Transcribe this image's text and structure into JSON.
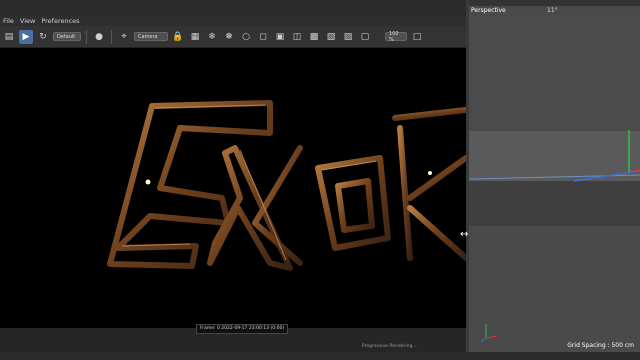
{
  "menu": {
    "items": [
      "File",
      "View",
      "Preferences"
    ]
  },
  "toolbar": {
    "render_preset": "Default",
    "camera_dropdown": "Camera",
    "zoom": "100 %"
  },
  "render_view": {
    "frame_info": "Frame: 0   2022-09-17  23:00:13  (0:00)",
    "progress_text": "Progressive Rendering..."
  },
  "viewport": {
    "title": "Perspective",
    "angle": "11°",
    "grid_spacing": "Grid Spacing : 500 cm"
  },
  "colors": {
    "active_button": "#4a6fa5",
    "rope_dark": "#3a2212",
    "rope_light": "#b57a3f"
  }
}
